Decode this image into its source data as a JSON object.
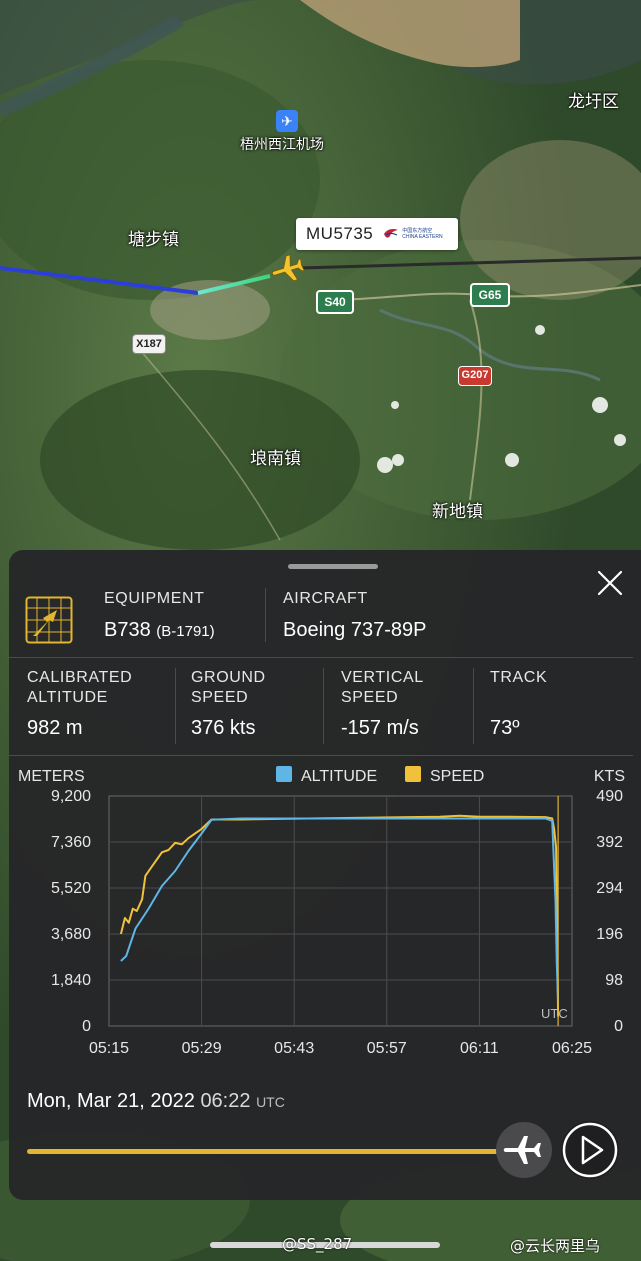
{
  "map": {
    "labels": {
      "longxu": "龙圩区",
      "airport": "梧州西江机场",
      "tangbu": "塘步镇",
      "langnan": "埌南镇",
      "xindi": "新地镇"
    },
    "roads": {
      "s40": "S40",
      "g65": "G65",
      "g207": "G207",
      "x187": "X187"
    },
    "flight_tag": {
      "callsign": "MU5735",
      "airline_cn": "中国东方航空",
      "airline_en": "CHINA EASTERN"
    }
  },
  "panel": {
    "equipment": {
      "label": "EQUIPMENT",
      "code": "B738",
      "reg": "(B-1791)"
    },
    "aircraft": {
      "label": "AIRCRAFT",
      "value": "Boeing 737-89P"
    },
    "stats": {
      "cal_alt_label_1": "CALIBRATED",
      "cal_alt_label_2": "ALTITUDE",
      "cal_alt_value": "982 m",
      "ground_speed_label_1": "GROUND",
      "ground_speed_label_2": "SPEED",
      "ground_speed_value": "376 kts",
      "vertical_speed_label_1": "VERTICAL",
      "vertical_speed_label_2": "SPEED",
      "vertical_speed_value": "-157 m/s",
      "track_label": "TRACK",
      "track_value": "73º"
    },
    "date": {
      "text": "Mon, Mar 21, 2022",
      "time": "06:22",
      "tz": "UTC"
    }
  },
  "chart_data": {
    "type": "line",
    "left_axis_title": "METERS",
    "right_axis_title": "KTS",
    "y_left_ticks": [
      "9,200",
      "7,360",
      "5,520",
      "3,680",
      "1,840",
      "0"
    ],
    "y_right_ticks": [
      "490",
      "392",
      "294",
      "196",
      "98",
      "0"
    ],
    "x_ticks": [
      "05:15",
      "05:29",
      "05:43",
      "05:57",
      "06:11",
      "06:25"
    ],
    "ylim_left": [
      0,
      9200
    ],
    "ylim_right": [
      0,
      490
    ],
    "xlim_minutes": [
      0,
      70
    ],
    "tz_label": "UTC",
    "legend": [
      "ALTITUDE",
      "SPEED"
    ],
    "colors": {
      "altitude": "#5fb6e6",
      "speed": "#f0c23c"
    },
    "series": [
      {
        "name": "ALTITUDE",
        "x": [
          1.8,
          2.6,
          4,
          6,
          8,
          10,
          12,
          14,
          15.5,
          20,
          30,
          40,
          50,
          60,
          66,
          67,
          67.5,
          67.7,
          67.9
        ],
        "values": [
          2600,
          2800,
          3900,
          4700,
          5600,
          6200,
          7000,
          7700,
          8250,
          8300,
          8300,
          8300,
          8300,
          8300,
          8300,
          8200,
          5000,
          2500,
          1000
        ]
      },
      {
        "name": "SPEED",
        "x": [
          1.8,
          2.4,
          3,
          3.6,
          4.2,
          5,
          5.5,
          6,
          7,
          8,
          9,
          10,
          11,
          12,
          13,
          14,
          15.5,
          20,
          30,
          40,
          50,
          53,
          56,
          60,
          66,
          67,
          67.3,
          67.6,
          67.9
        ],
        "values": [
          196,
          230,
          220,
          250,
          245,
          270,
          320,
          330,
          350,
          370,
          375,
          390,
          387,
          400,
          410,
          420,
          440,
          440,
          442,
          444,
          446,
          448,
          446,
          446,
          445,
          442,
          420,
          380,
          20
        ]
      }
    ]
  },
  "watermarks": {
    "left": "@SS_287",
    "right": "@云长两里乌"
  }
}
